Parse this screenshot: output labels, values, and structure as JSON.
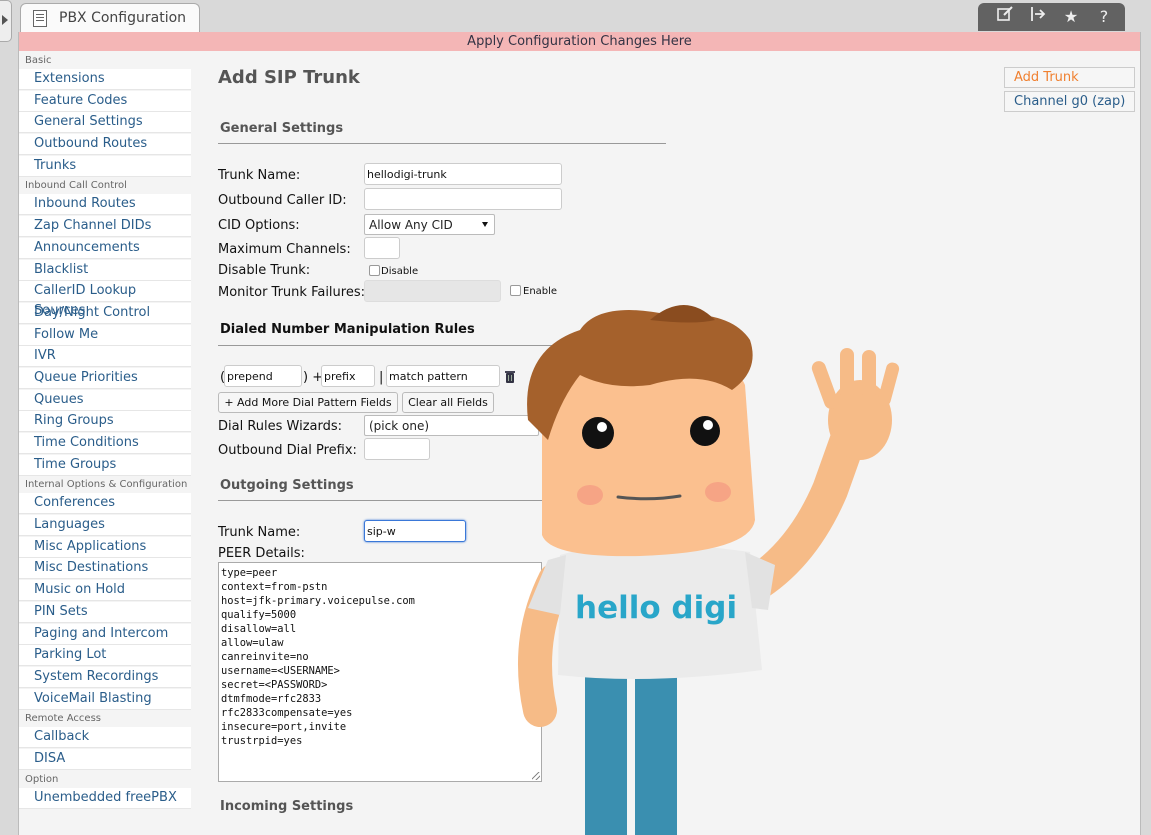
{
  "tab": {
    "title": "PBX Configuration"
  },
  "toolbar": {
    "icons": [
      "edit-icon",
      "exit-icon",
      "star-icon",
      "help-icon"
    ],
    "star": "★",
    "help": "?"
  },
  "apply_bar": {
    "label": "Apply Configuration Changes Here"
  },
  "sidebar": {
    "basic": {
      "title": "Basic",
      "items": [
        "Extensions",
        "Feature Codes",
        "General Settings",
        "Outbound Routes",
        "Trunks"
      ]
    },
    "inbound": {
      "title": "Inbound Call Control",
      "items": [
        "Inbound Routes",
        "Zap Channel DIDs",
        "Announcements",
        "Blacklist",
        "CallerID Lookup Sources",
        "Day/Night Control",
        "Follow Me",
        "IVR",
        "Queue Priorities",
        "Queues",
        "Ring Groups",
        "Time Conditions",
        "Time Groups"
      ]
    },
    "internal": {
      "title": "Internal Options & Configuration",
      "items": [
        "Conferences",
        "Languages",
        "Misc Applications",
        "Misc Destinations",
        "Music on Hold",
        "PIN Sets",
        "Paging and Intercom",
        "Parking Lot",
        "System Recordings",
        "VoiceMail Blasting"
      ]
    },
    "remote": {
      "title": "Remote Access",
      "items": [
        "Callback",
        "DISA"
      ]
    },
    "option": {
      "title": "Option",
      "items": [
        "Unembedded freePBX"
      ]
    }
  },
  "main": {
    "title": "Add SIP Trunk",
    "general": {
      "heading": "General Settings",
      "trunk_name_label": "Trunk Name:",
      "trunk_name_value": "hellodigi-trunk",
      "outbound_cid_label": "Outbound Caller ID:",
      "outbound_cid_value": "",
      "cid_options_label": "CID Options:",
      "cid_options_value": "Allow Any CID",
      "max_channels_label": "Maximum Channels:",
      "max_channels_value": "",
      "disable_trunk_label": "Disable Trunk:",
      "disable_label": "Disable",
      "monitor_label": "Monitor Trunk Failures:",
      "enable_label": "Enable"
    },
    "dial": {
      "heading": "Dialed Number Manipulation Rules",
      "open_paren": "(",
      "prepend_placeholder": "prepend",
      "close_plus": ") +",
      "prefix_placeholder": "prefix",
      "pipe": "|",
      "pattern_placeholder": "match pattern",
      "add_more_label": "+ Add More Dial Pattern Fields",
      "clear_label": "Clear all Fields",
      "wizards_label": "Dial Rules Wizards:",
      "wizards_value": "(pick one)",
      "prefix_label": "Outbound Dial Prefix:",
      "prefix_value": ""
    },
    "outgoing": {
      "heading": "Outgoing Settings",
      "trunk_name_label": "Trunk Name:",
      "trunk_name_value": "sip-w",
      "peer_label": "PEER Details:",
      "peer_lines": [
        "type=peer",
        "context=from-pstn",
        "host=jfk-primary.voicepulse.com",
        "qualify=5000",
        "disallow=all",
        "allow=ulaw",
        "canreinvite=no",
        "username=<USERNAME>",
        "secret=<PASSWORD>",
        "dtmfmode=rfc2833",
        "rfc2833compensate=yes",
        "insecure=port,invite",
        "trustrpid=yes"
      ]
    },
    "incoming": {
      "heading": "Incoming Settings"
    }
  },
  "right_links": {
    "add_trunk": "Add Trunk",
    "channel": "Channel g0 (zap)"
  },
  "mascot": {
    "shirt_text": "hello digi"
  },
  "colors": {
    "apply_bar": "#f4b6b6",
    "link": "#2a5d8a",
    "active_link": "#f08030",
    "focus": "#3a78d8",
    "mascot_text": "#29a6c9"
  }
}
